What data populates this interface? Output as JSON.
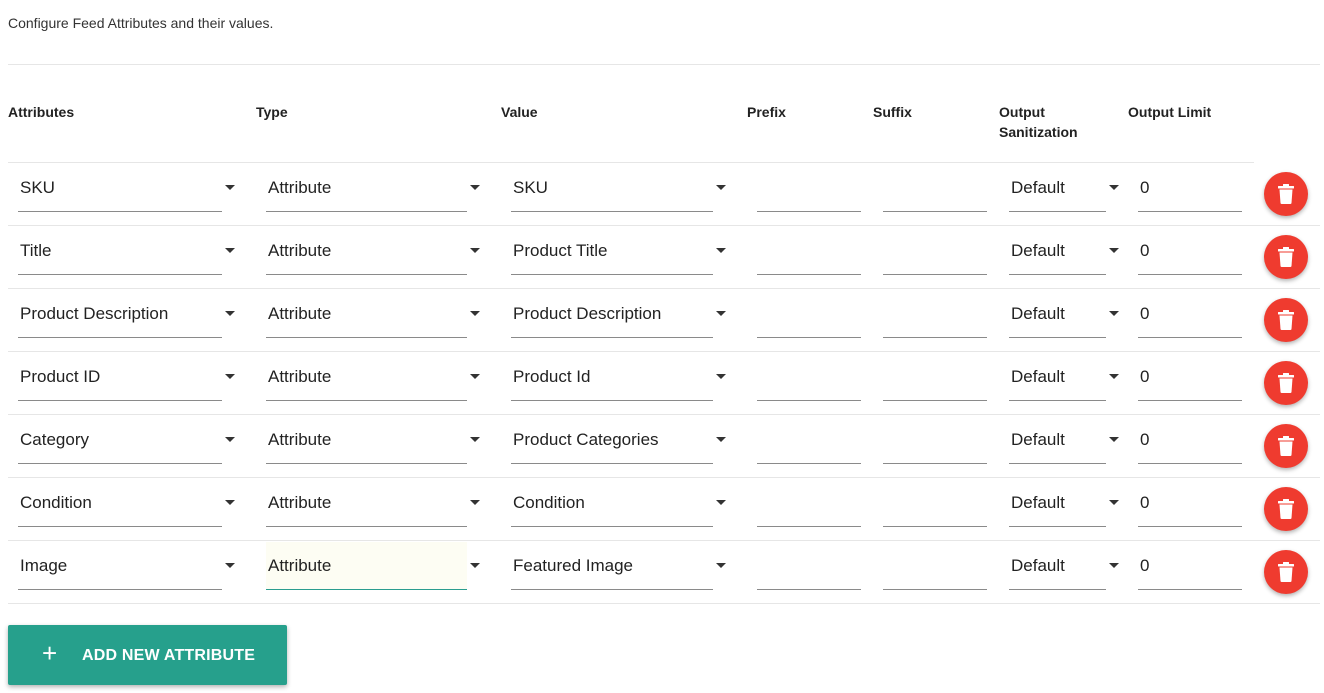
{
  "intro_text": "Configure Feed Attributes and their values.",
  "headers": {
    "attributes": "Attributes",
    "type": "Type",
    "value": "Value",
    "prefix": "Prefix",
    "suffix": "Suffix",
    "output_sanitization_line1": "Output",
    "output_sanitization_line2": "Sanitization",
    "output_limit": "Output Limit"
  },
  "rows": [
    {
      "attribute": "SKU",
      "type": "Attribute",
      "value": "SKU",
      "prefix": "",
      "suffix": "",
      "sanitization": "Default",
      "limit": "0"
    },
    {
      "attribute": "Title",
      "type": "Attribute",
      "value": "Product Title",
      "prefix": "",
      "suffix": "",
      "sanitization": "Default",
      "limit": "0"
    },
    {
      "attribute": "Product Description",
      "type": "Attribute",
      "value": "Product Description",
      "prefix": "",
      "suffix": "",
      "sanitization": "Default",
      "limit": "0"
    },
    {
      "attribute": "Product ID",
      "type": "Attribute",
      "value": "Product Id",
      "prefix": "",
      "suffix": "",
      "sanitization": "Default",
      "limit": "0"
    },
    {
      "attribute": "Category",
      "type": "Attribute",
      "value": "Product Categories",
      "prefix": "",
      "suffix": "",
      "sanitization": "Default",
      "limit": "0"
    },
    {
      "attribute": "Condition",
      "type": "Attribute",
      "value": "Condition",
      "prefix": "",
      "suffix": "",
      "sanitization": "Default",
      "limit": "0"
    },
    {
      "attribute": "Image",
      "type": "Attribute",
      "value": "Featured Image",
      "prefix": "",
      "suffix": "",
      "sanitization": "Default",
      "limit": "0"
    }
  ],
  "add_button": {
    "icon": "plus-icon",
    "label": "ADD NEW ATTRIBUTE"
  },
  "colors": {
    "accent": "#26a08c",
    "delete": "#ef3b2f"
  }
}
